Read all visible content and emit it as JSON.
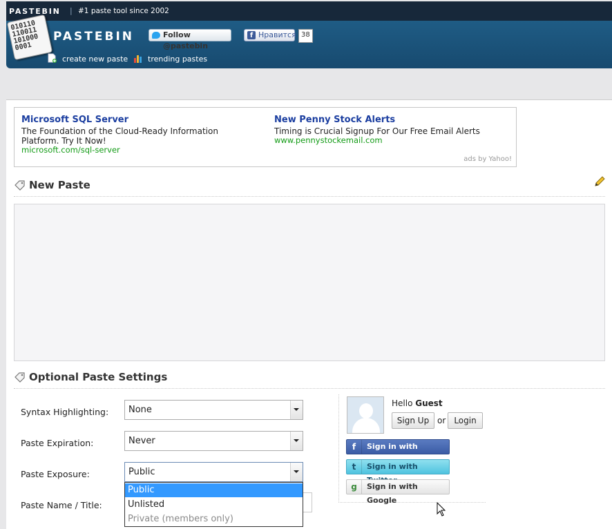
{
  "topbar": {
    "brand": "PASTEBIN",
    "separator": "|",
    "tagline": "#1 paste tool since 2002"
  },
  "header": {
    "logo_binary": [
      "010110",
      "110011",
      "101000",
      "0001"
    ],
    "logo_text": "PASTEBIN",
    "twitter_follow": "Follow @pastebin",
    "facebook_like": "Нравится",
    "facebook_count": "38",
    "nav": {
      "create_new_paste": "create new paste",
      "trending_pastes": "trending pastes"
    }
  },
  "ads": {
    "left": {
      "title": "Microsoft SQL Server",
      "description": "The Foundation of the Cloud-Ready Information Platform. Try It Now!",
      "url": "microsoft.com/sql-server"
    },
    "right": {
      "title": "New Penny Stock Alerts",
      "description": "Timing is Crucial Signup For Our Free Email Alerts",
      "url": "www.pennystockemail.com"
    },
    "attribution": "ads by Yahoo!"
  },
  "new_paste": {
    "title": "New Paste",
    "content": ""
  },
  "settings": {
    "title": "Optional Paste Settings",
    "syntax_label": "Syntax Highlighting:",
    "syntax_value": "None",
    "expiration_label": "Paste Expiration:",
    "expiration_value": "Never",
    "exposure_label": "Paste Exposure:",
    "exposure_value": "Public",
    "exposure_options": [
      "Public",
      "Unlisted",
      "Private (members only)"
    ],
    "name_label": "Paste Name / Title:"
  },
  "login": {
    "hello": "Hello",
    "user": "Guest",
    "signup": "Sign Up",
    "or": "or",
    "login": "Login",
    "facebook": "Sign in with Facebook",
    "twitter": "Sign in with Twitter",
    "google": "Sign in with Google"
  },
  "colors": {
    "header_bg": "#1f5c85",
    "topbar_bg": "#17283a",
    "ad_title": "#1b3ea0",
    "ad_url": "#139b16",
    "dropdown_selected": "#3399ff"
  }
}
